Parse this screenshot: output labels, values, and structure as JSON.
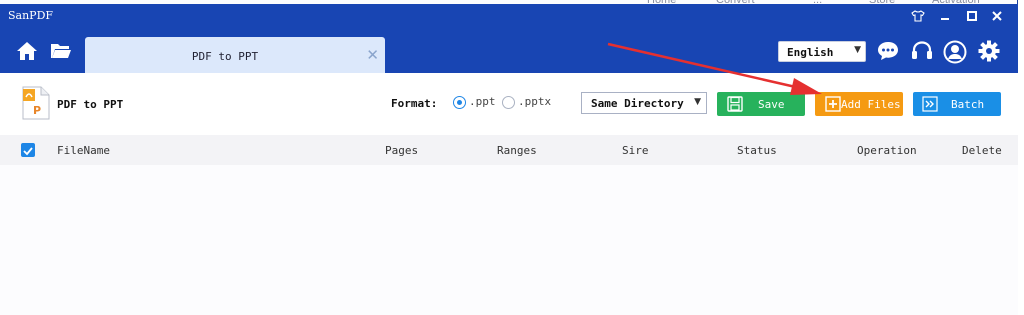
{
  "app": {
    "title": "SanPDF"
  },
  "background_window": {
    "menu": [
      "Home",
      "Convert",
      "...",
      "Store",
      "Activation"
    ]
  },
  "tab": {
    "label": "PDF to PPT",
    "close_glyph": "✕"
  },
  "language": {
    "selected": "English"
  },
  "page": {
    "title": "PDF to PPT"
  },
  "format": {
    "label": "Format:",
    "options": [
      {
        "label": ".ppt",
        "selected": true
      },
      {
        "label": ".pptx",
        "selected": false
      }
    ]
  },
  "output_dir": {
    "selected": "Same Directory"
  },
  "buttons": {
    "save": "Save",
    "add_files": "Add Files",
    "batch": "Batch"
  },
  "table": {
    "columns": [
      "FileName",
      "Pages",
      "Ranges",
      "Sire",
      "Status",
      "Operation",
      "Delete"
    ],
    "rows": []
  },
  "icons": [
    "home-icon",
    "folder-icon",
    "shirt-icon",
    "minimize-icon",
    "maximize-icon",
    "close-icon",
    "chat-icon",
    "headset-icon",
    "user-icon",
    "gear-icon",
    "pdf-file-icon",
    "save-icon",
    "plus-icon",
    "batch-icon",
    "checkbox-icon"
  ],
  "colors": {
    "titlebar": "#1845b3",
    "tab": "#dce8fb",
    "save": "#27b25c",
    "add": "#f59a12",
    "batch": "#1a8fe6",
    "annotation_arrow": "#e53030"
  }
}
